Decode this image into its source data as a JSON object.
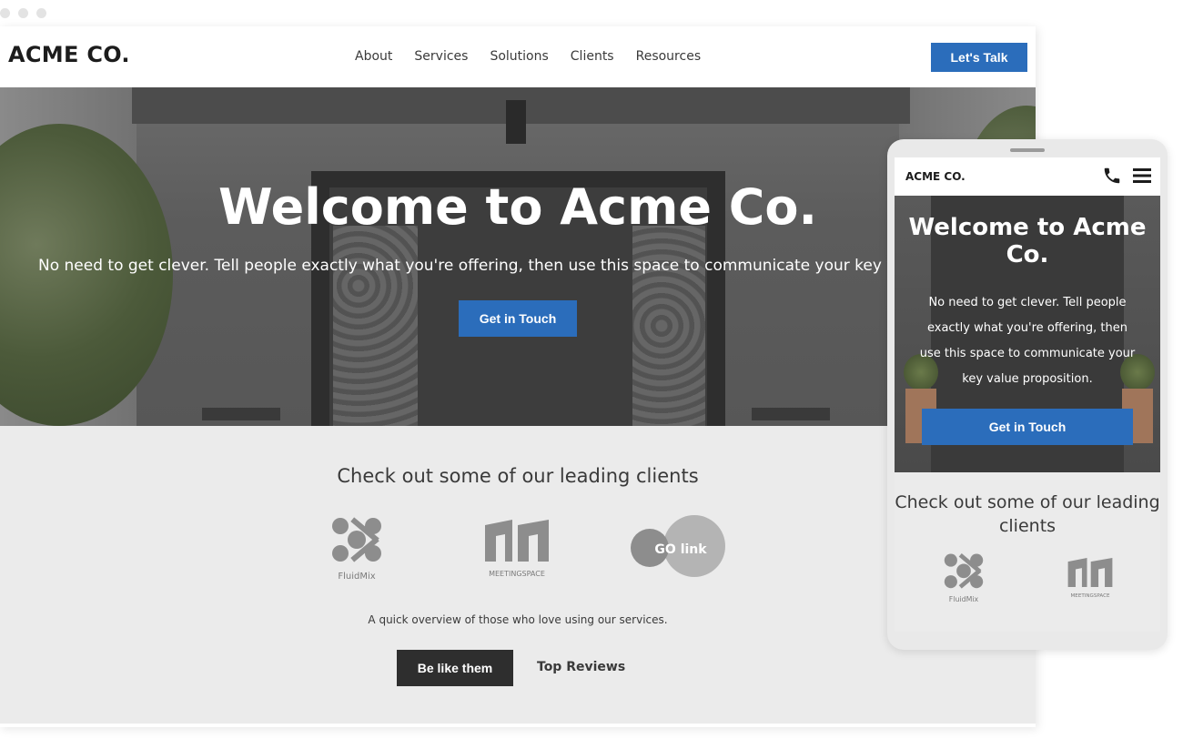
{
  "header": {
    "logo": "ACME CO.",
    "nav": [
      "About",
      "Services",
      "Solutions",
      "Clients",
      "Resources"
    ],
    "cta": "Let's Talk"
  },
  "hero": {
    "title": "Welcome to Acme Co.",
    "subtitle": "No need to get clever. Tell people exactly what you're offering, then use this space to communicate your key value proposition.",
    "button": "Get in Touch"
  },
  "clients": {
    "title": "Check out some of our leading clients",
    "logos": [
      "FluidMix",
      "MEETINGSPACE",
      "GO link"
    ],
    "note": "A quick overview of those who love using our services.",
    "primary_button": "Be like them",
    "secondary_link": "Top Reviews"
  },
  "mobile": {
    "logo": "ACME CO.",
    "hero_title": "Welcome to Acme Co.",
    "hero_subtitle": "No need to get clever. Tell people exactly what you're offering, then use this space to communicate your key value proposition.",
    "hero_button": "Get in Touch",
    "clients_title": "Check out some of our leading clients"
  },
  "colors": {
    "primary": "#2b6dbb",
    "dark": "#2e2e2e",
    "section_bg": "#ebebeb"
  }
}
